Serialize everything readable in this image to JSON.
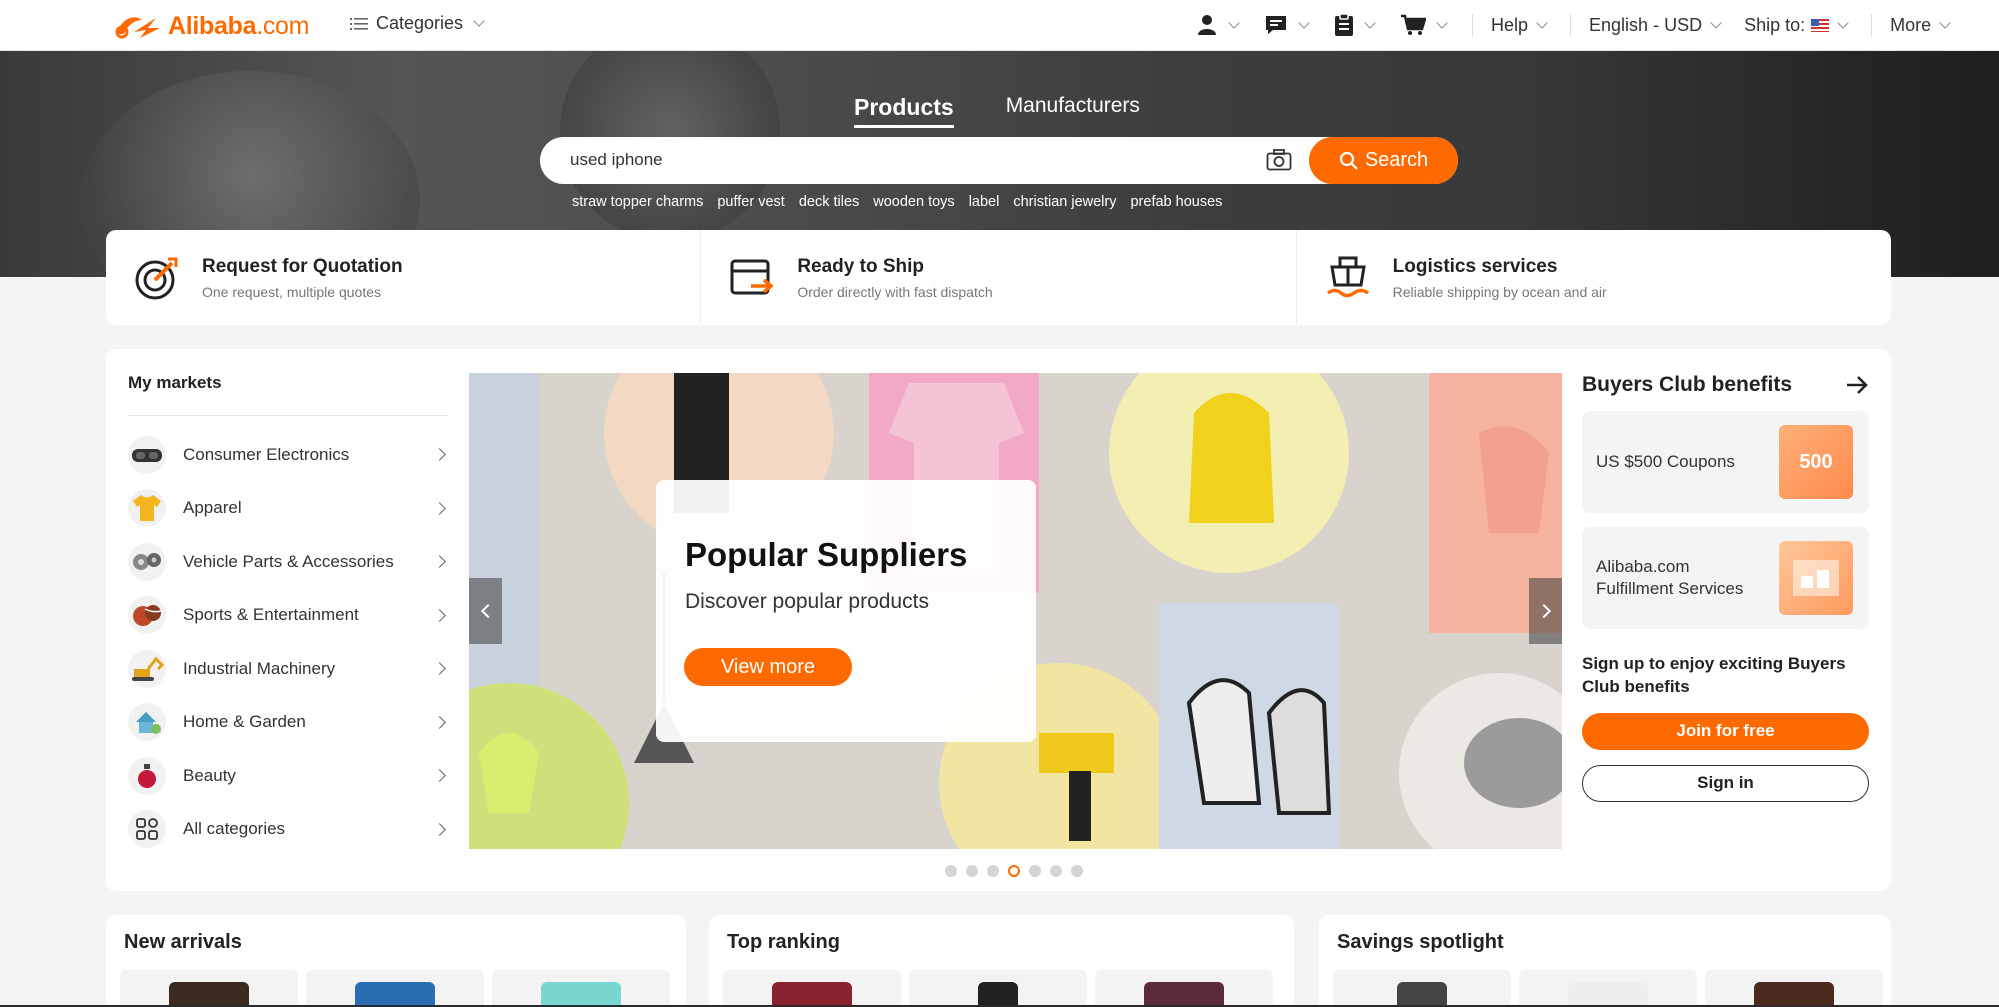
{
  "topbar": {
    "logo_text": "Alibaba",
    "logo_domain": ".com",
    "categories_label": "Categories",
    "help_label": "Help",
    "language_label": "English - USD",
    "ship_to_label": "Ship to:",
    "more_label": "More"
  },
  "hero": {
    "tabs": [
      {
        "label": "Products",
        "active": true
      },
      {
        "label": "Manufacturers",
        "active": false
      }
    ],
    "search": {
      "value": "used iphone",
      "button_label": "Search"
    },
    "suggestions": [
      "straw topper charms",
      "puffer vest",
      "deck tiles",
      "wooden toys",
      "label",
      "christian jewelry",
      "prefab houses"
    ]
  },
  "services": [
    {
      "title": "Request for Quotation",
      "subtitle": "One request, multiple quotes",
      "icon": "target-icon"
    },
    {
      "title": "Ready to Ship",
      "subtitle": "Order directly with fast dispatch",
      "icon": "ship-box-icon"
    },
    {
      "title": "Logistics services",
      "subtitle": "Reliable shipping by ocean and air",
      "icon": "cargo-ship-icon"
    }
  ],
  "markets": {
    "title": "My markets",
    "items": [
      {
        "label": "Consumer Electronics",
        "icon": "vr-headset-icon"
      },
      {
        "label": "Apparel",
        "icon": "tshirt-icon"
      },
      {
        "label": "Vehicle Parts & Accessories",
        "icon": "car-parts-icon"
      },
      {
        "label": "Sports & Entertainment",
        "icon": "sports-ball-icon"
      },
      {
        "label": "Industrial Machinery",
        "icon": "excavator-icon"
      },
      {
        "label": "Home & Garden",
        "icon": "home-garden-icon"
      },
      {
        "label": "Beauty",
        "icon": "perfume-icon"
      },
      {
        "label": "All categories",
        "icon": "grid-icon"
      }
    ]
  },
  "banner": {
    "title": "Popular Suppliers",
    "subtitle": "Discover popular products",
    "button_label": "View more",
    "slide_count": 7,
    "active_slide": 4
  },
  "club": {
    "title": "Buyers Club benefits",
    "cards": [
      {
        "label": "US $500 Coupons",
        "badge": "500"
      },
      {
        "label": "Alibaba.com Fulfillment Services",
        "badge": ""
      }
    ],
    "note": "Sign up to enjoy exciting Buyers Club benefits",
    "join_label": "Join for free",
    "signin_label": "Sign in"
  },
  "sections": [
    {
      "title": "New arrivals"
    },
    {
      "title": "Top ranking"
    },
    {
      "title": "Savings spotlight"
    }
  ],
  "colors": {
    "brand": "#ff6a00"
  }
}
